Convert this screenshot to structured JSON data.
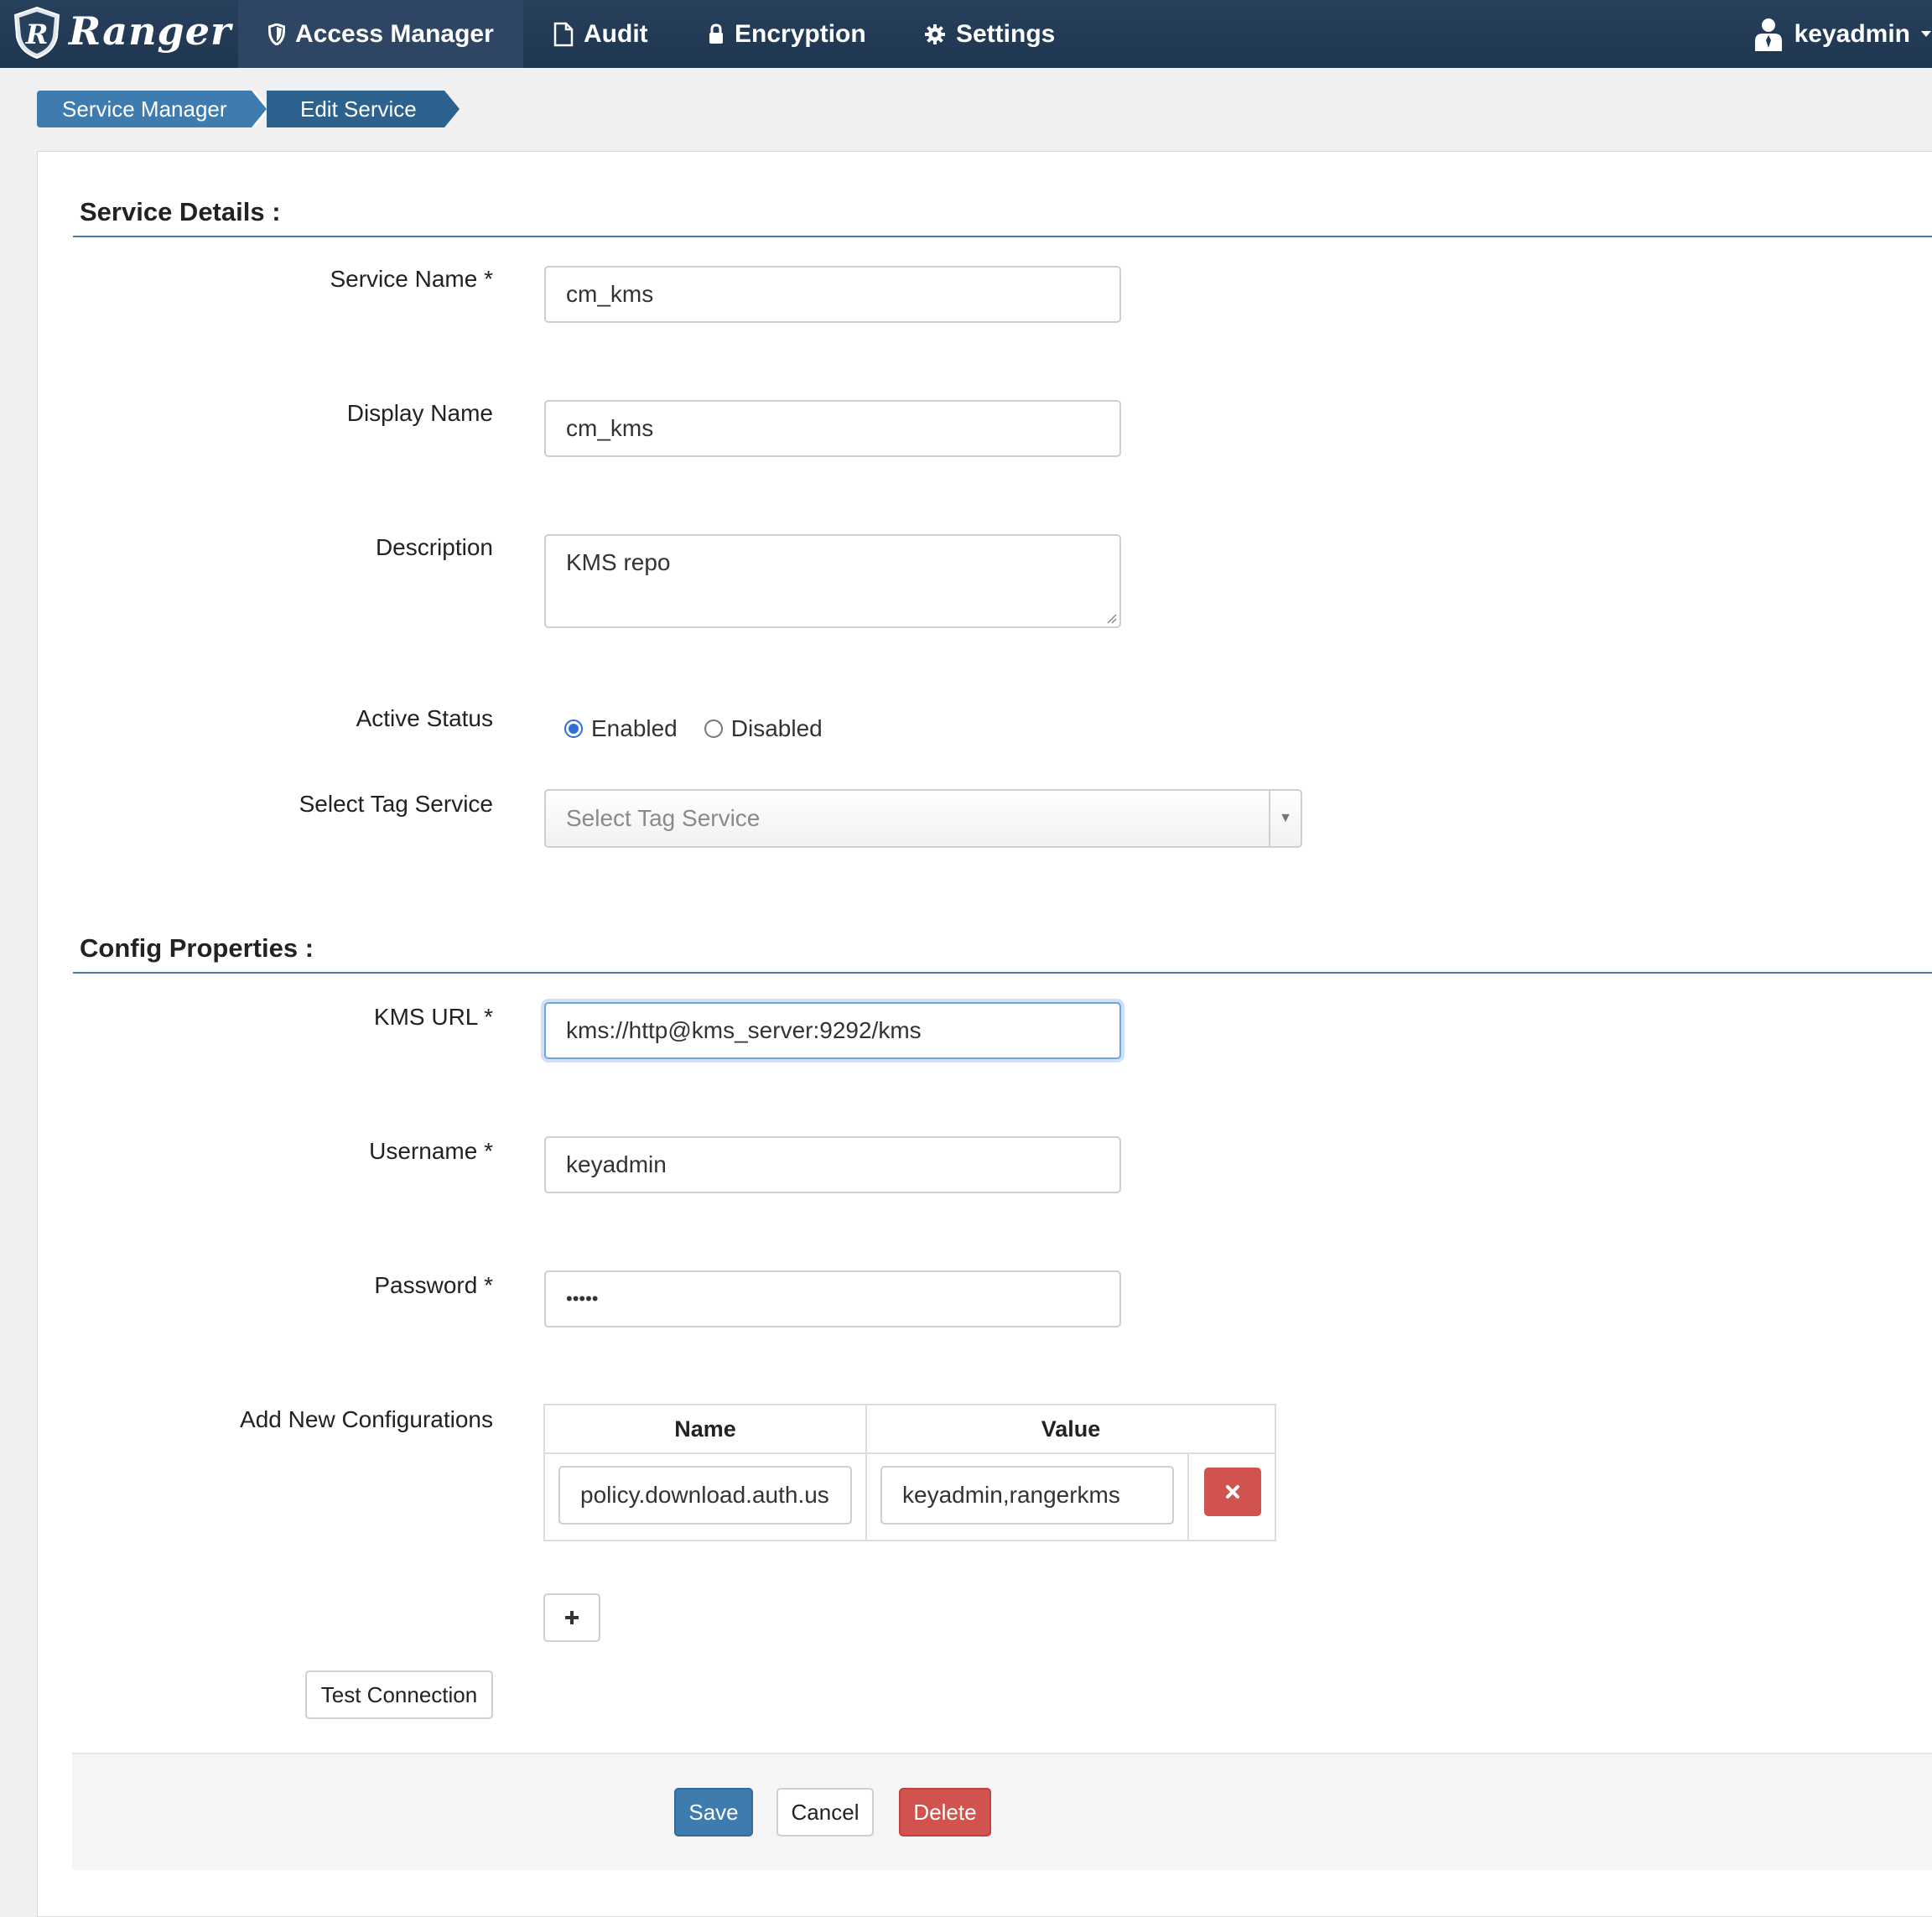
{
  "nav": {
    "brand": "Ranger",
    "items": [
      {
        "label": "Access Manager",
        "icon": "shield-icon"
      },
      {
        "label": "Audit",
        "icon": "file-icon"
      },
      {
        "label": "Encryption",
        "icon": "lock-icon"
      },
      {
        "label": "Settings",
        "icon": "gear-icon"
      }
    ],
    "user": "keyadmin"
  },
  "breadcrumb": [
    "Service Manager",
    "Edit Service"
  ],
  "service_details": {
    "title": "Service Details :",
    "service_name_label": "Service Name *",
    "service_name_value": "cm_kms",
    "display_name_label": "Display Name",
    "display_name_value": "cm_kms",
    "description_label": "Description",
    "description_value": "KMS repo",
    "active_status_label": "Active Status",
    "enabled_label": "Enabled",
    "disabled_label": "Disabled",
    "active_status_selected": "Enabled",
    "tag_service_label": "Select Tag Service",
    "tag_service_placeholder": "Select Tag Service"
  },
  "config_properties": {
    "title": "Config Properties :",
    "kms_url_label": "KMS URL *",
    "kms_url_value": "kms://http@kms_server:9292/kms",
    "username_label": "Username *",
    "username_value": "keyadmin",
    "password_label": "Password *",
    "password_value": "•••••",
    "add_configs_label": "Add New Configurations",
    "table_headers": [
      "Name",
      "Value"
    ],
    "rows": [
      {
        "name": "policy.download.auth.us",
        "value": "keyadmin,rangerkms"
      }
    ],
    "test_connection_label": "Test Connection"
  },
  "actions": {
    "save": "Save",
    "cancel": "Cancel",
    "delete": "Delete"
  },
  "colors": {
    "navbar": "#243b55",
    "primary": "#3e7cb0",
    "danger": "#d0534f",
    "section_rule": "#4a7aa5"
  }
}
